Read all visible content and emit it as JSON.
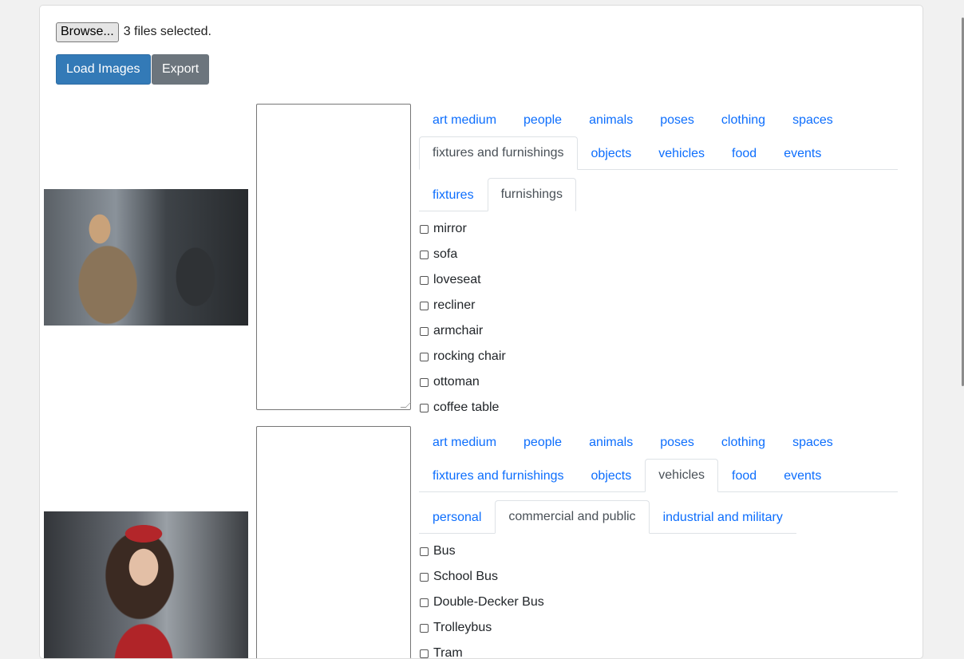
{
  "file_input": {
    "browse_label": "Browse...",
    "status": "3 files selected."
  },
  "toolbar": {
    "load_label": "Load Images",
    "export_label": "Export"
  },
  "entries": [
    {
      "image_alt": "woman operating machinery in factory",
      "tabs_row1": [
        "art medium",
        "people",
        "animals",
        "poses",
        "clothing",
        "spaces"
      ],
      "tabs_row2": [
        "fixtures and furnishings",
        "objects",
        "vehicles",
        "food",
        "events"
      ],
      "active_tab": "fixtures and furnishings",
      "subtabs": [
        "fixtures",
        "furnishings"
      ],
      "active_subtab": "furnishings",
      "items": [
        "mirror",
        "sofa",
        "loveseat",
        "recliner",
        "armchair",
        "rocking chair",
        "ottoman",
        "coffee table"
      ]
    },
    {
      "image_alt": "girl in red uniform and beret",
      "tabs_row1": [
        "art medium",
        "people",
        "animals",
        "poses",
        "clothing",
        "spaces"
      ],
      "tabs_row2": [
        "fixtures and furnishings",
        "objects",
        "vehicles",
        "food",
        "events"
      ],
      "active_tab": "vehicles",
      "subtabs": [
        "personal",
        "commercial and public",
        "industrial and military"
      ],
      "active_subtab": "commercial and public",
      "items": [
        "Bus",
        "School Bus",
        "Double-Decker Bus",
        "Trolleybus",
        "Tram"
      ]
    }
  ],
  "colors": {
    "primary": "#337ab7",
    "secondary": "#6c757d",
    "link": "#0d6efd"
  }
}
